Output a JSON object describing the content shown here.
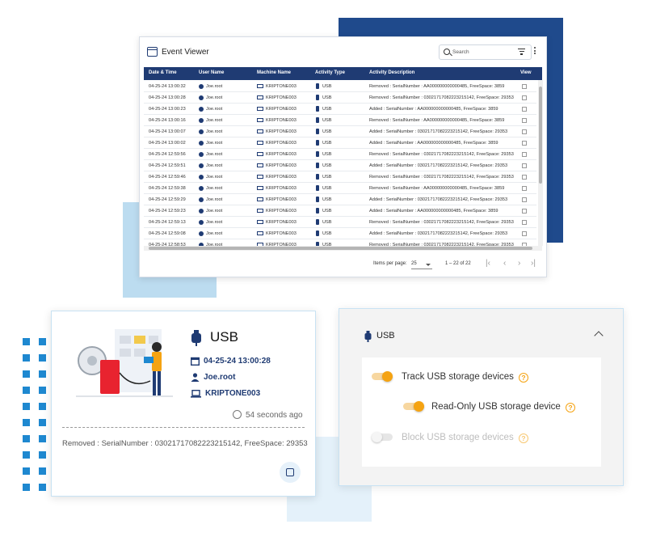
{
  "colors": {
    "navy": "#1f3b73",
    "deco_navy": "#1f4a8c",
    "accent_blue": "#1e88d0",
    "toggle_orange": "#f5a312",
    "toggle_track_on": "#f7d7a0",
    "disabled_text": "#bdbdbd"
  },
  "event_viewer": {
    "title": "Event Viewer",
    "search_placeholder": "Search",
    "columns": [
      "Date & Time",
      "User Name",
      "Machine Name",
      "Activity Type",
      "Activity Description",
      "View"
    ],
    "rows": [
      {
        "time": "04-25-24 13:00:32",
        "user": "Joe.root",
        "machine": "KRIPTONE003",
        "type": "USB",
        "desc": "Removed : SerialNumber : AA000000000000485, FreeSpace: 3859"
      },
      {
        "time": "04-25-24 13:00:28",
        "user": "Joe.root",
        "machine": "KRIPTONE003",
        "type": "USB",
        "desc": "Removed : SerialNumber : 03021717082223215142, FreeSpace: 29353"
      },
      {
        "time": "04-25-24 13:00:23",
        "user": "Joe.root",
        "machine": "KRIPTONE003",
        "type": "USB",
        "desc": "Added : SerialNumber : AA000000000000485, FreeSpace: 3859"
      },
      {
        "time": "04-25-24 13:00:16",
        "user": "Joe.root",
        "machine": "KRIPTONE003",
        "type": "USB",
        "desc": "Removed : SerialNumber : AA000000000000485, FreeSpace: 3859"
      },
      {
        "time": "04-25-24 13:00:07",
        "user": "Joe.root",
        "machine": "KRIPTONE003",
        "type": "USB",
        "desc": "Added : SerialNumber : 03021717082223215142, FreeSpace: 29353"
      },
      {
        "time": "04-25-24 13:00:02",
        "user": "Joe.root",
        "machine": "KRIPTONE003",
        "type": "USB",
        "desc": "Added : SerialNumber : AA000000000000485, FreeSpace: 3859"
      },
      {
        "time": "04-25-24 12:59:56",
        "user": "Joe.root",
        "machine": "KRIPTONE003",
        "type": "USB",
        "desc": "Removed : SerialNumber : 03021717082223215142, FreeSpace: 29353"
      },
      {
        "time": "04-25-24 12:59:51",
        "user": "Joe.root",
        "machine": "KRIPTONE003",
        "type": "USB",
        "desc": "Added : SerialNumber : 03021717082223215142, FreeSpace: 29353"
      },
      {
        "time": "04-25-24 12:59:46",
        "user": "Joe.root",
        "machine": "KRIPTONE003",
        "type": "USB",
        "desc": "Removed : SerialNumber : 03021717082223215142, FreeSpace: 29353"
      },
      {
        "time": "04-25-24 12:59:38",
        "user": "Joe.root",
        "machine": "KRIPTONE003",
        "type": "USB",
        "desc": "Removed : SerialNumber : AA000000000000485, FreeSpace: 3859"
      },
      {
        "time": "04-25-24 12:59:29",
        "user": "Joe.root",
        "machine": "KRIPTONE003",
        "type": "USB",
        "desc": "Added : SerialNumber : 03021717082223215142, FreeSpace: 29353"
      },
      {
        "time": "04-25-24 12:59:23",
        "user": "Joe.root",
        "machine": "KRIPTONE003",
        "type": "USB",
        "desc": "Added : SerialNumber : AA000000000000485, FreeSpace: 3859"
      },
      {
        "time": "04-25-24 12:59:13",
        "user": "Joe.root",
        "machine": "KRIPTONE003",
        "type": "USB",
        "desc": "Removed : SerialNumber : 03021717082223215142, FreeSpace: 29353"
      },
      {
        "time": "04-25-24 12:59:08",
        "user": "Joe.root",
        "machine": "KRIPTONE003",
        "type": "USB",
        "desc": "Added : SerialNumber : 03021717082223215142, FreeSpace: 29353"
      },
      {
        "time": "04-25-24 12:58:53",
        "user": "Joe.root",
        "machine": "KRIPTONE003",
        "type": "USB",
        "desc": "Removed : SerialNumber : 03021717082223215142, FreeSpace: 29353"
      }
    ],
    "items_per_page_label": "Items per page:",
    "items_per_page_value": "25",
    "range_label": "1 – 22 of 22",
    "pager": {
      "first": "|‹",
      "prev": "‹",
      "next": "›",
      "last": "›|"
    }
  },
  "usb_card": {
    "title": "USB",
    "datetime": "04-25-24 13:00:28",
    "user": "Joe.root",
    "machine": "KRIPTONE003",
    "time_ago": "54 seconds ago",
    "description": "Removed : SerialNumber : 03021717082223215142, FreeSpace: 29353"
  },
  "usb_settings": {
    "title": "USB",
    "options": [
      {
        "label": "Track USB storage devices",
        "enabled": true,
        "disabled_ui": false
      },
      {
        "label": "Read-Only USB storage device",
        "enabled": true,
        "disabled_ui": false
      },
      {
        "label": "Block USB storage devices",
        "enabled": false,
        "disabled_ui": true
      }
    ],
    "help_glyph": "?"
  }
}
